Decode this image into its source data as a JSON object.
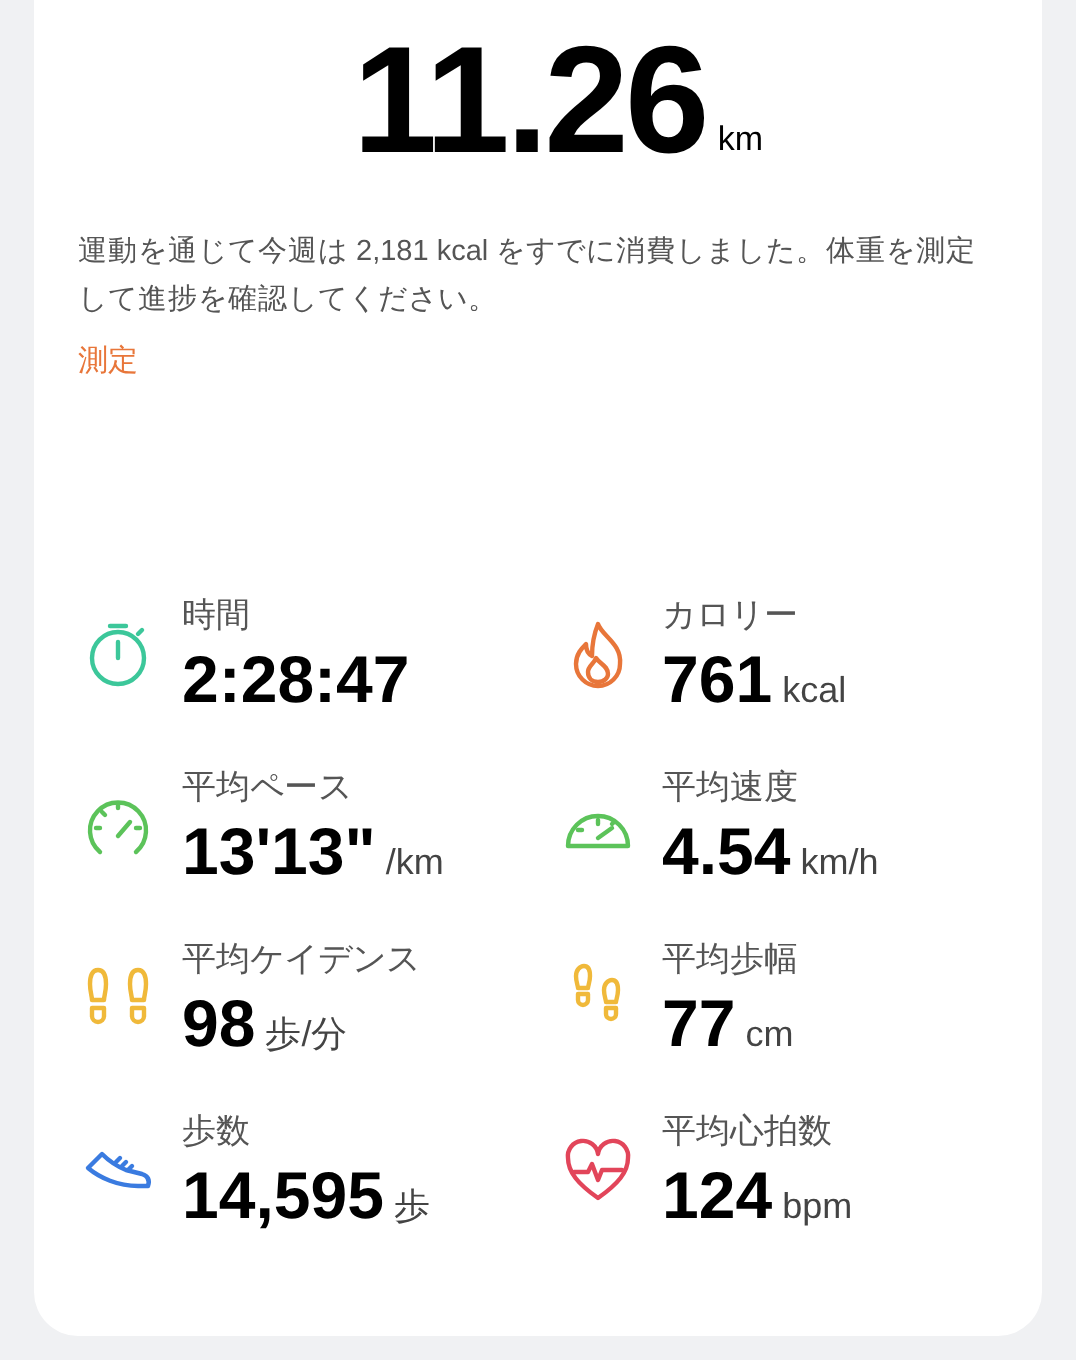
{
  "distance": {
    "value": "11.26",
    "unit": "km"
  },
  "message": "運動を通じて今週は 2,181 kcal をすでに消費しました。体重を測定して進捗を確認してください。",
  "measure_link": "測定",
  "metrics": [
    {
      "kind": "stopwatch",
      "label": "時間",
      "value": "2:28:47"
    },
    {
      "kind": "flame",
      "label": "カロリー",
      "value": "761",
      "unit": "kcal"
    },
    {
      "kind": "gauge",
      "label": "平均ペース",
      "value": "13'13\"",
      "unit": "/km"
    },
    {
      "kind": "speedometer",
      "label": "平均速度",
      "value": "4.54",
      "unit": "km/h"
    },
    {
      "kind": "footprints",
      "label": "平均ケイデンス",
      "value": "98",
      "unit": "歩/分"
    },
    {
      "kind": "footsteps",
      "label": "平均歩幅",
      "value": "77",
      "unit": "cm"
    },
    {
      "kind": "shoe",
      "label": "歩数",
      "value": "14,595",
      "unit": "歩"
    },
    {
      "kind": "heart",
      "label": "平均心拍数",
      "value": "124",
      "unit": "bpm"
    }
  ]
}
